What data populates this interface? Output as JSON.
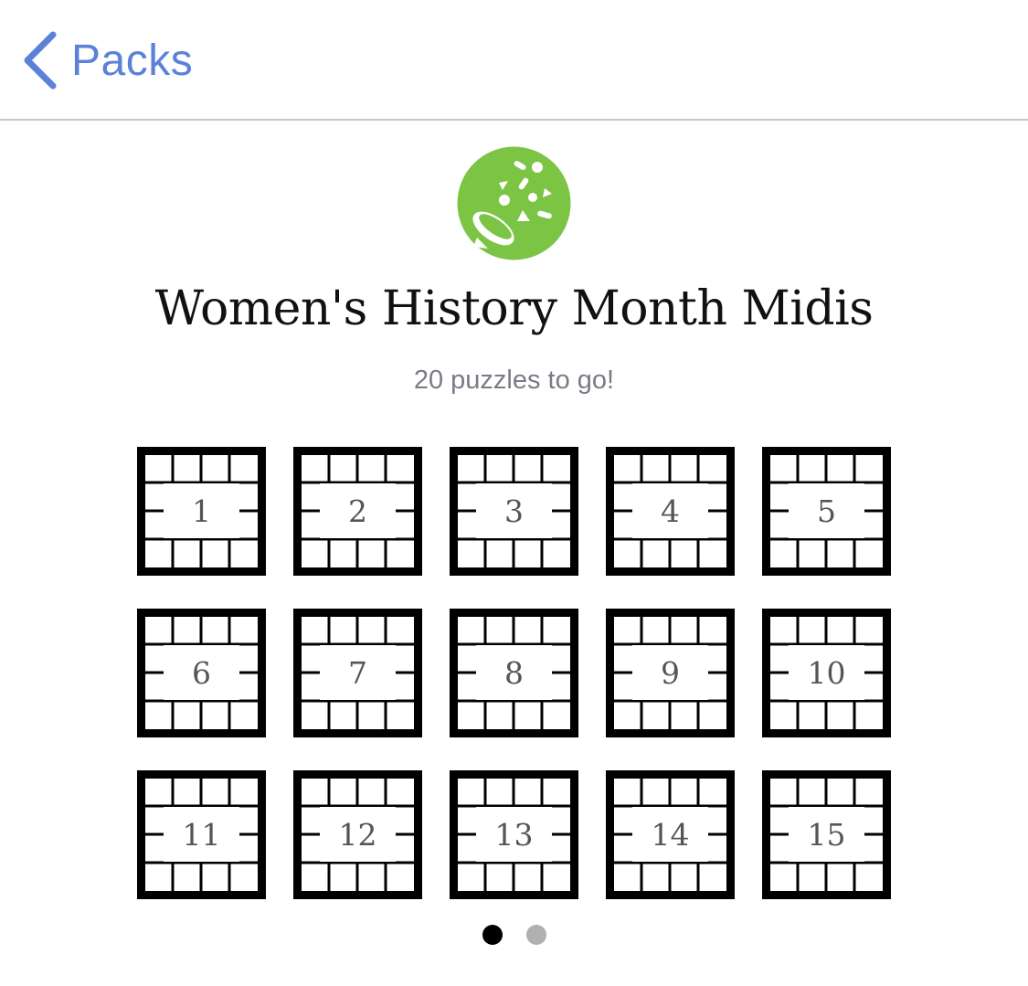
{
  "nav": {
    "back_label": "Packs",
    "back_icon": "chevron-left-icon",
    "accent_color": "#5b82d8"
  },
  "pack": {
    "icon": "party-popper-icon",
    "icon_color": "#7cc444",
    "title": "Women's History Month Midis",
    "subtitle": "20 puzzles to go!"
  },
  "puzzles": [
    "1",
    "2",
    "3",
    "4",
    "5",
    "6",
    "7",
    "8",
    "9",
    "10",
    "11",
    "12",
    "13",
    "14",
    "15"
  ],
  "pagination": {
    "pages": 2,
    "current": 1,
    "active_color": "#000000",
    "inactive_color": "#b0b0b0"
  }
}
